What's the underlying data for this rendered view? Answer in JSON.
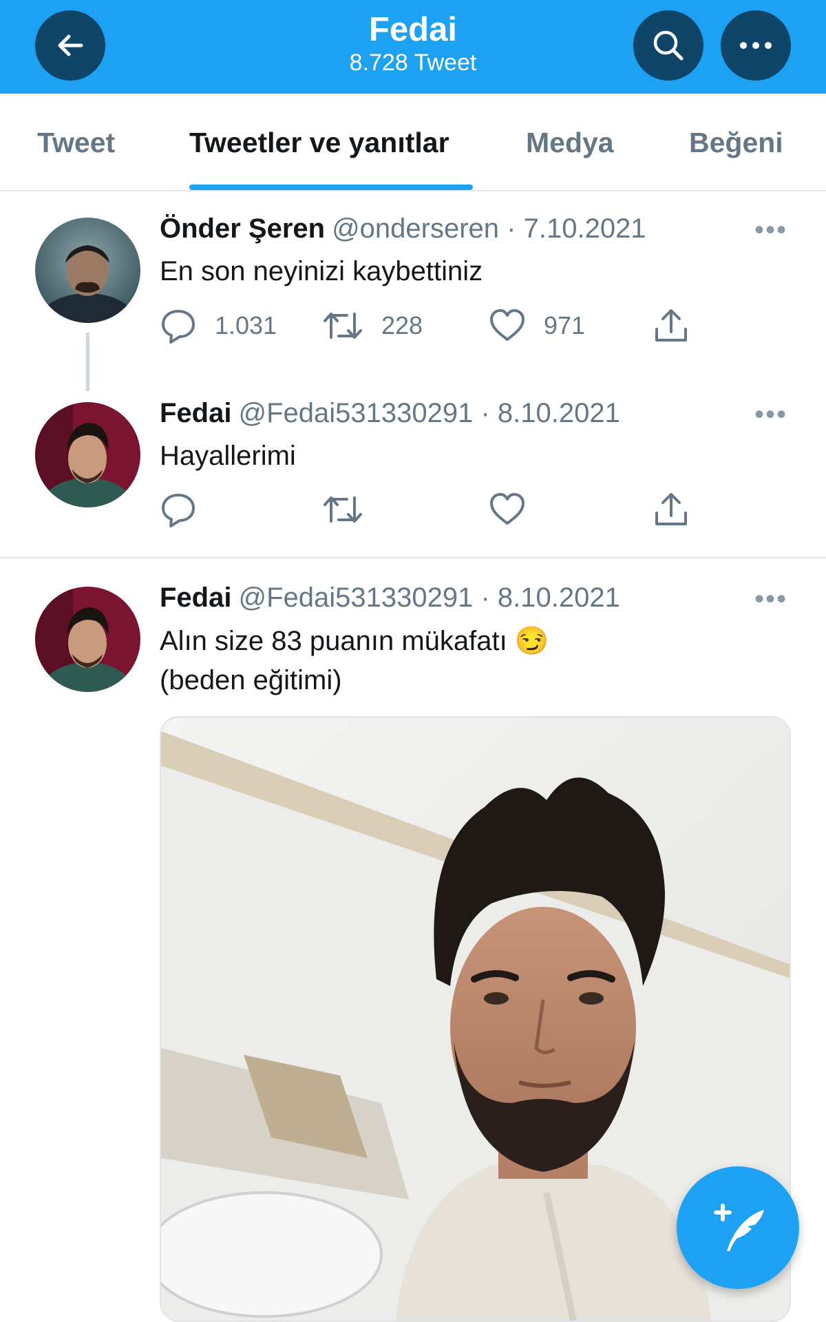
{
  "header": {
    "title": "Fedai",
    "subtitle": "8.728 Tweet",
    "accent": "#1da1f2",
    "icons": [
      "arrow-left-icon",
      "search-icon",
      "more-horizontal-icon"
    ]
  },
  "tabs": [
    {
      "label": "Tweet",
      "active": false
    },
    {
      "label": "Tweetler ve yanıtlar",
      "active": true
    },
    {
      "label": "Medya",
      "active": false
    },
    {
      "label": "Beğeni",
      "active": false
    }
  ],
  "tweets": [
    {
      "name": "Önder Şeren",
      "handle": "@onderseren",
      "date": "· 7.10.2021",
      "text": "En son neyinizi kaybettiniz",
      "replies": "1.031",
      "retweets": "228",
      "likes": "971"
    },
    {
      "name": "Fedai",
      "handle": "@Fedai531330291",
      "date": "· 8.10.2021",
      "text": "Hayallerimi"
    },
    {
      "name": "Fedai",
      "handle": "@Fedai531330291",
      "date": "· 8.10.2021",
      "text_line1": "Alın size 83 puanın mükafatı 😏",
      "text_line2": "(beden eğitimi)"
    }
  ],
  "more_glyph": "•••",
  "fab": {
    "icon": "compose-tweet-icon"
  }
}
